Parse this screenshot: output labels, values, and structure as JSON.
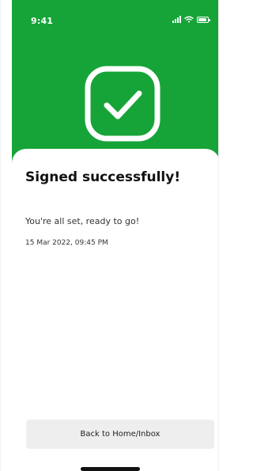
{
  "status_bar": {
    "time": "9:41",
    "icons": [
      "signal-icon",
      "wifi-icon",
      "battery-icon"
    ]
  },
  "success": {
    "icon": "check-square-icon",
    "title": "Signed successfully!",
    "message": "You're all set, ready to go!",
    "timestamp": "15 Mar 2022, 09:45 PM"
  },
  "actions": {
    "back_label": "Back to Home/Inbox"
  },
  "colors": {
    "accent": "#16a438",
    "button_bg": "#eeeeee",
    "text": "#111111"
  }
}
